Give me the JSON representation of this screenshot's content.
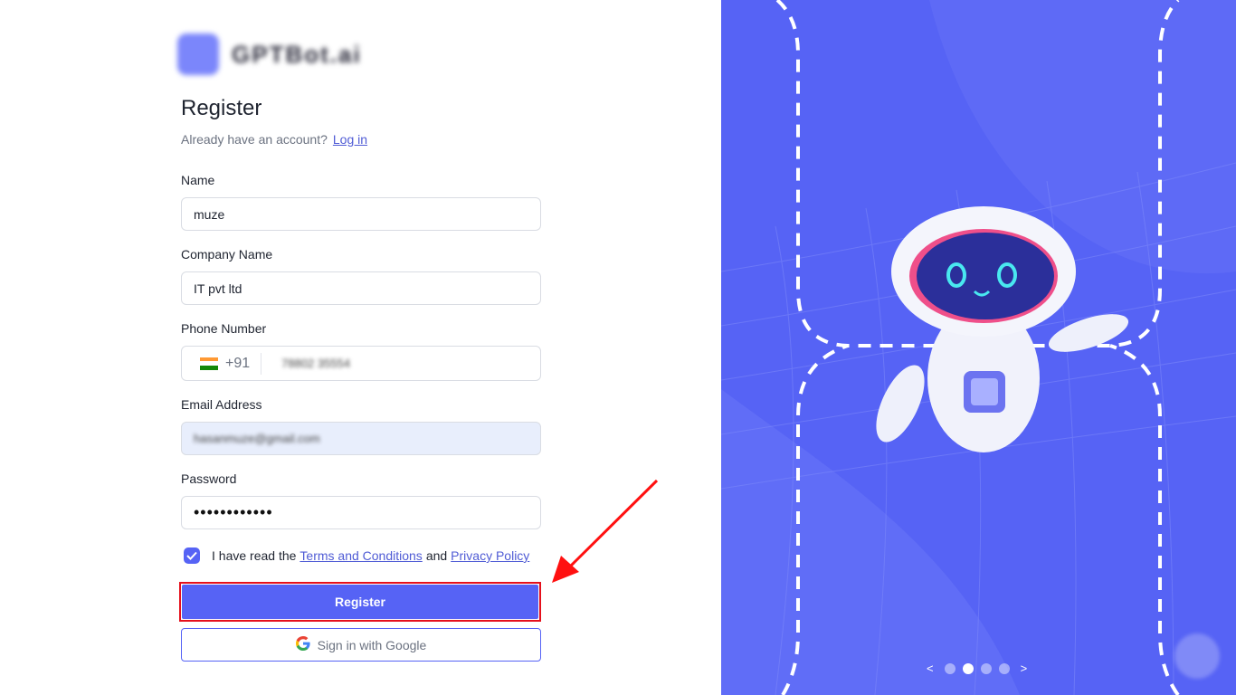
{
  "brand": {
    "logo_text": "GPTBot.ai"
  },
  "form": {
    "title": "Register",
    "login_prompt": "Already have an account?",
    "login_link": "Log in",
    "name": {
      "label": "Name",
      "value": "muze"
    },
    "company": {
      "label": "Company Name",
      "value": "IT pvt ltd"
    },
    "phone": {
      "label": "Phone Number",
      "country_code": "+91",
      "value": "78802 35554"
    },
    "email": {
      "label": "Email Address",
      "value": "hasanmuze@gmail.com"
    },
    "password": {
      "label": "Password",
      "value": "••••••••••••"
    },
    "agree": {
      "prefix": "I have read the",
      "terms": "Terms and Conditions",
      "and": "and",
      "privacy": "Privacy Policy",
      "checked": true
    },
    "register_button": "Register",
    "google_button": "Sign in with Google"
  },
  "carousel": {
    "prev": "<",
    "next": ">",
    "slides": 4,
    "active_index": 1
  },
  "colors": {
    "accent": "#5663f5",
    "highlight": "#e5101c",
    "panel": "#5663f5"
  }
}
